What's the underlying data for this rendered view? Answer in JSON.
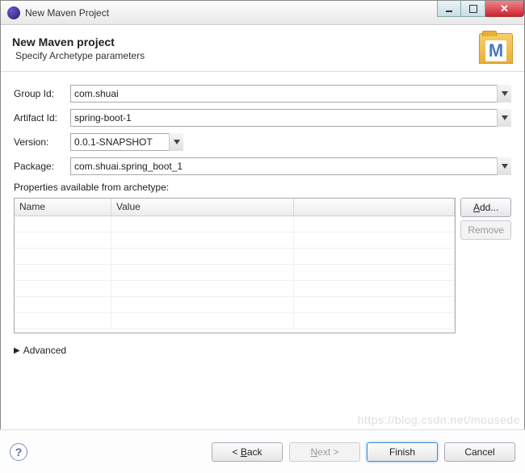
{
  "window": {
    "title": "New Maven Project"
  },
  "banner": {
    "heading": "New Maven project",
    "subheading": "Specify Archetype parameters",
    "icon_letter": "M"
  },
  "form": {
    "group_id_label": "Group Id:",
    "group_id_value": "com.shuai",
    "artifact_id_label": "Artifact Id:",
    "artifact_id_value": "spring-boot-1",
    "version_label": "Version:",
    "version_value": "0.0.1-SNAPSHOT",
    "package_label": "Package:",
    "package_value": "com.shuai.spring_boot_1"
  },
  "properties": {
    "heading": "Properties available from archetype:",
    "col_name": "Name",
    "col_value": "Value",
    "add_label": "Add...",
    "remove_label": "Remove"
  },
  "advanced": {
    "label": "Advanced"
  },
  "footer": {
    "help": "?",
    "back": "< Back",
    "next": "Next >",
    "finish": "Finish",
    "cancel": "Cancel"
  },
  "watermark": "https://blog.csdn.net/mousede"
}
